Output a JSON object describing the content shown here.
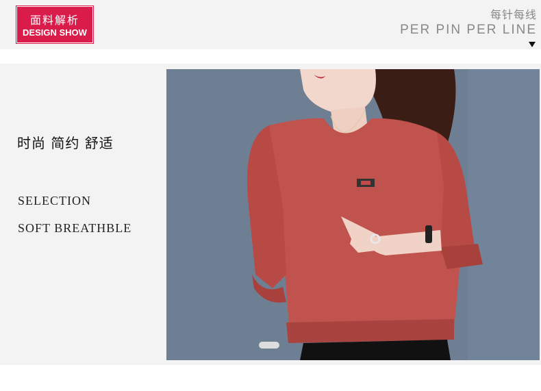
{
  "header": {
    "badge_cn": "面料解析",
    "badge_en": "DESIGN SHOW",
    "title_cn": "每针每线",
    "title_en": "PER PIN PER LINE"
  },
  "section": {
    "tagline": "时尚 简约 舒适",
    "features": [
      "SELECTION",
      "SOFT BREATHBLE"
    ]
  },
  "photo": {
    "subject": "model-wearing-red-blouse",
    "colors": {
      "background": "#6f7f93",
      "blouse": "#c1534e",
      "skin": "#f1d7cc"
    }
  }
}
